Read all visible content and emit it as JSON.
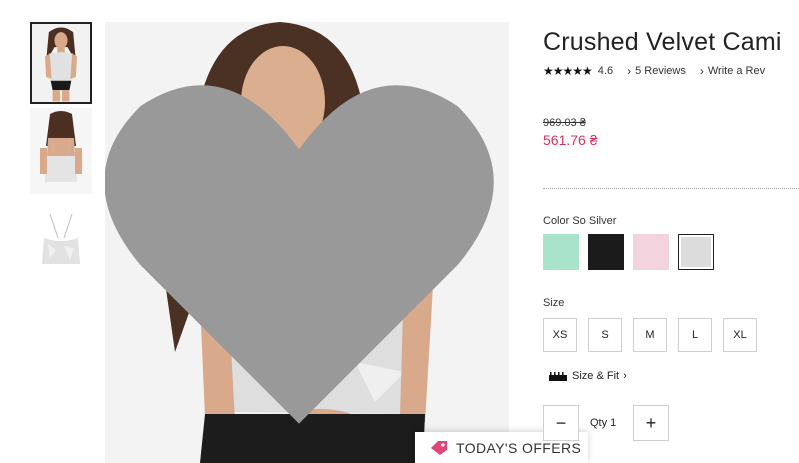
{
  "product": {
    "title": "Crushed Velvet Cami",
    "rating": {
      "stars": "★★★★★",
      "value": "4.6",
      "score": 4.6
    },
    "reviews_link": "5 Reviews",
    "write_review_link": "Write a Rev",
    "chevron": "›"
  },
  "price": {
    "original": "969.03 ₴",
    "sale": "561.76 ₴",
    "sale_color": "#d4305e"
  },
  "color": {
    "label": "Color So Silver",
    "swatches": [
      {
        "name": "mint",
        "hex": "#a9e3c9"
      },
      {
        "name": "black",
        "hex": "#1b1b1b"
      },
      {
        "name": "pink",
        "hex": "#f3d3dd"
      },
      {
        "name": "silver",
        "hex": "#dcdcdc",
        "selected": true
      }
    ]
  },
  "size": {
    "label": "Size",
    "options": [
      "XS",
      "S",
      "M",
      "L",
      "XL"
    ],
    "fit_link": "Size & Fit",
    "fit_chevron": "›"
  },
  "quantity": {
    "minus": "−",
    "label": "Qty 1",
    "plus": "+"
  },
  "offers": {
    "label": "TODAY'S OFFERS",
    "icon": "tag-icon"
  },
  "gallery": {
    "thumbnails": [
      {
        "icon": "model-front-thumbnail",
        "selected": true
      },
      {
        "icon": "model-back-thumbnail"
      },
      {
        "icon": "product-flat-thumbnail"
      }
    ],
    "favorite_icon": "heart-icon"
  }
}
